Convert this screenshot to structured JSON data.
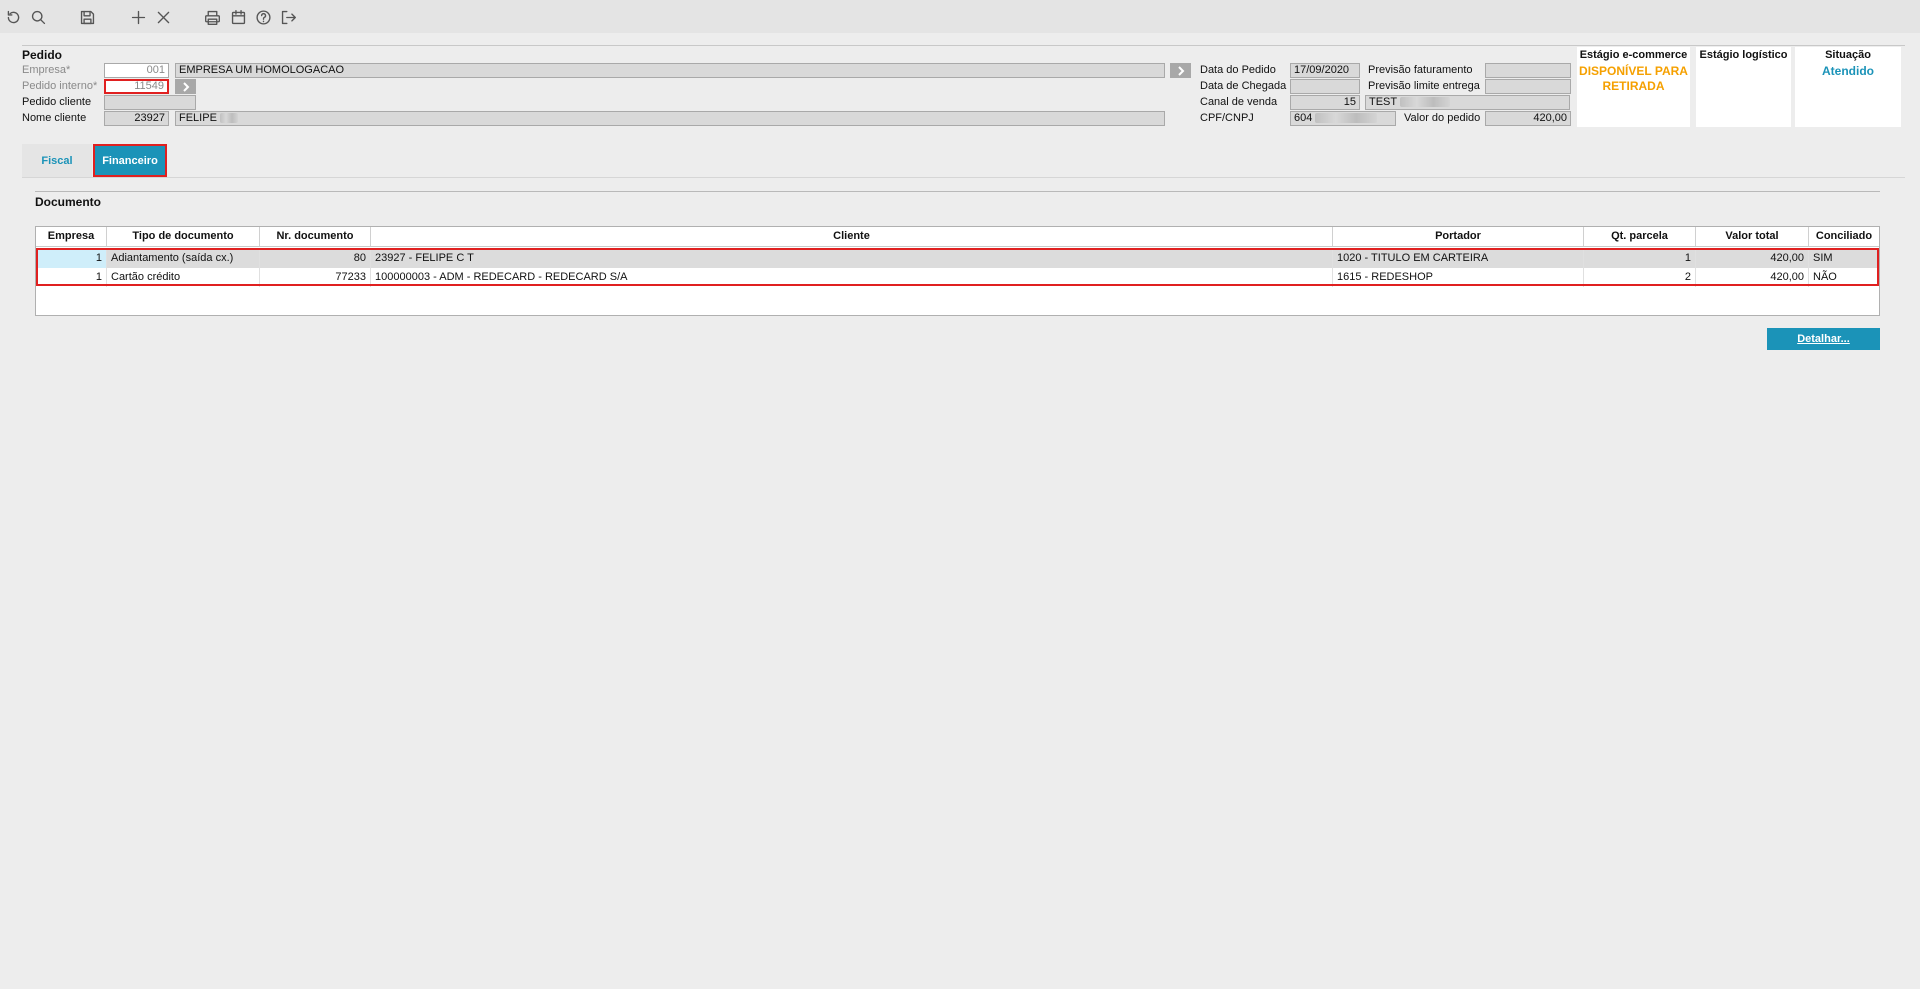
{
  "toolbar": {
    "icons": [
      "refresh-icon",
      "search-icon",
      "save-icon",
      "add-icon",
      "close-icon",
      "print-icon",
      "calendar-icon",
      "help-icon",
      "exit-icon"
    ]
  },
  "pedido": {
    "title": "Pedido",
    "empresa_label": "Empresa*",
    "empresa_code": "001",
    "empresa_name": "EMPRESA UM HOMOLOGACAO",
    "pedido_interno_label": "Pedido interno*",
    "pedido_interno_value": "11549",
    "pedido_cliente_label": "Pedido cliente",
    "pedido_cliente_value": "",
    "nome_cliente_label": "Nome cliente",
    "nome_cliente_code": "23927",
    "nome_cliente_name": "FELIPE"
  },
  "datas": {
    "data_pedido_label": "Data do Pedido",
    "data_pedido_value": "17/09/2020",
    "data_chegada_label": "Data de Chegada",
    "data_chegada_value": "",
    "canal_venda_label": "Canal de venda",
    "canal_venda_code": "15",
    "canal_venda_name": "TEST",
    "cpf_label": "CPF/CNPJ",
    "cpf_value": "604",
    "previsao_faturamento_label": "Previsão faturamento",
    "previsao_faturamento_value": "",
    "previsao_limite_label": "Previsão limite entrega",
    "previsao_limite_value": "",
    "valor_pedido_label": "Valor do pedido",
    "valor_pedido_value": "420,00"
  },
  "stages": {
    "ecommerce_title": "Estágio e-commerce",
    "ecommerce_value": "DISPONÍVEL PARA RETIRADA",
    "logistico_title": "Estágio logístico",
    "logistico_value": "",
    "situacao_title": "Situação",
    "situacao_value": "Atendido",
    "colors": {
      "orange": "#f5a000",
      "teal": "#1b93b8"
    }
  },
  "tabs": [
    {
      "label": "Fiscal",
      "active": false
    },
    {
      "label": "Financeiro",
      "active": true
    }
  ],
  "documento": {
    "title": "Documento",
    "columns": [
      "Empresa",
      "Tipo de documento",
      "Nr. documento",
      "Cliente",
      "Portador",
      "Qt. parcela",
      "Valor total",
      "Conciliado"
    ],
    "rows": [
      [
        "1",
        "Adiantamento (saída cx.)",
        "80",
        "23927 - FELIPE C T",
        "1020 - TITULO EM CARTEIRA",
        "1",
        "420,00",
        "SIM"
      ],
      [
        "1",
        "Cartão crédito",
        "77233",
        "100000003 - ADM - REDECARD - REDECARD S/A",
        "1615 - REDESHOP",
        "2",
        "420,00",
        "NÃO"
      ]
    ],
    "detail_button": "Detalhar..."
  }
}
